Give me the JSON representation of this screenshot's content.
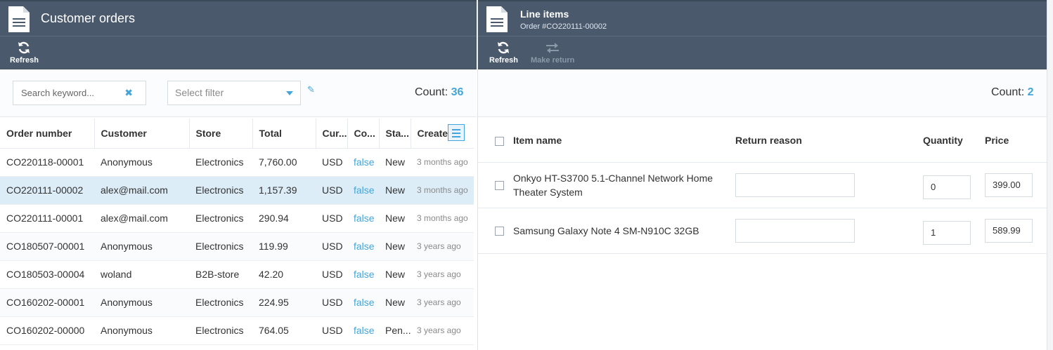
{
  "left": {
    "title": "Customer orders",
    "toolbar": {
      "refresh": "Refresh"
    },
    "search": {
      "placeholder": "Search keyword..."
    },
    "filter": {
      "placeholder": "Select filter"
    },
    "count_label": "Count:",
    "count_value": "36",
    "columns": [
      "Order number",
      "Customer",
      "Store",
      "Total",
      "Cur...",
      "Co...",
      "Sta...",
      "Create"
    ],
    "rows": [
      {
        "number": "CO220118-00001",
        "customer": "Anonymous",
        "store": "Electronics",
        "total": "7,760.00",
        "currency": "USD",
        "confirmed": "false",
        "status": "New",
        "created": "3 months ago"
      },
      {
        "number": "CO220111-00002",
        "customer": "alex@mail.com",
        "store": "Electronics",
        "total": "1,157.39",
        "currency": "USD",
        "confirmed": "false",
        "status": "New",
        "created": "3 months ago"
      },
      {
        "number": "CO220111-00001",
        "customer": "alex@mail.com",
        "store": "Electronics",
        "total": "290.94",
        "currency": "USD",
        "confirmed": "false",
        "status": "New",
        "created": "3 months ago"
      },
      {
        "number": "CO180507-00001",
        "customer": "Anonymous",
        "store": "Electronics",
        "total": "119.99",
        "currency": "USD",
        "confirmed": "false",
        "status": "New",
        "created": "3 years ago"
      },
      {
        "number": "CO180503-00004",
        "customer": "woland",
        "store": "B2B-store",
        "total": "42.20",
        "currency": "USD",
        "confirmed": "false",
        "status": "New",
        "created": "3 years ago"
      },
      {
        "number": "CO160202-00001",
        "customer": "Anonymous",
        "store": "Electronics",
        "total": "224.95",
        "currency": "USD",
        "confirmed": "false",
        "status": "New",
        "created": "3 years ago"
      },
      {
        "number": "CO160202-00000",
        "customer": "Anonymous",
        "store": "Electronics",
        "total": "764.05",
        "currency": "USD",
        "confirmed": "false",
        "status": "Pen...",
        "created": "3 years ago"
      }
    ]
  },
  "right": {
    "title": "Line items",
    "subtitle": "Order #CO220111-00002",
    "toolbar": {
      "refresh": "Refresh",
      "make_return": "Make return"
    },
    "count_label": "Count:",
    "count_value": "2",
    "columns": {
      "name": "Item name",
      "reason": "Return reason",
      "quantity": "Quantity",
      "price": "Price"
    },
    "items": [
      {
        "name": "Onkyo HT-S3700 5.1-Channel Network Home Theater System",
        "reason": "",
        "quantity": "0",
        "price": "399.00"
      },
      {
        "name": "Samsung Galaxy Note 4 SM-N910C 32GB",
        "reason": "",
        "quantity": "1",
        "price": "589.99"
      }
    ]
  },
  "colors": {
    "header": "#4a5a6c",
    "accent": "#43a5d9",
    "selected_row": "#dcedf8"
  },
  "icons": [
    "document-icon",
    "refresh-icon",
    "swap-icon",
    "clear-icon",
    "caret-down-icon",
    "pencil-icon",
    "column-menu-icon"
  ]
}
